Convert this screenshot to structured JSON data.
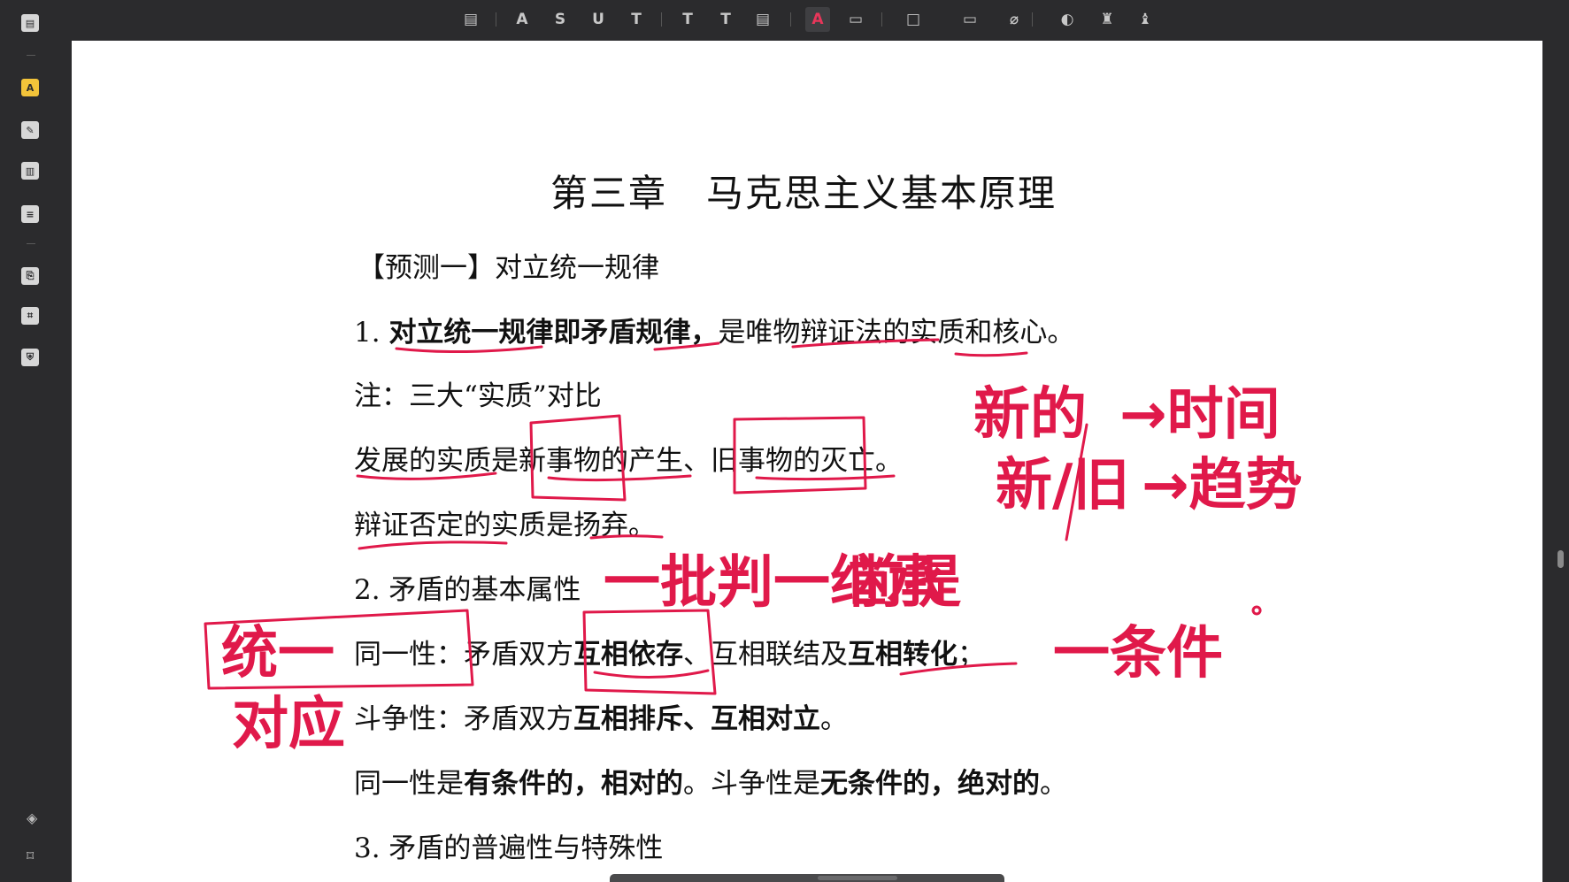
{
  "toolbar": {
    "tools": [
      {
        "name": "comment-icon",
        "glyph": "▤"
      },
      {
        "name": "highlight-icon",
        "glyph": "A"
      },
      {
        "name": "strikethrough-icon",
        "glyph": "S"
      },
      {
        "name": "underline-icon",
        "glyph": "U"
      },
      {
        "name": "squiggly-icon",
        "glyph": "T"
      },
      {
        "name": "text-icon",
        "glyph": "T"
      },
      {
        "name": "textbox-icon",
        "glyph": "T"
      },
      {
        "name": "note-icon",
        "glyph": "▤"
      },
      {
        "name": "pen-icon",
        "glyph": "A"
      },
      {
        "name": "eraser-icon",
        "glyph": "▭"
      },
      {
        "name": "shape-icon",
        "glyph": "□"
      },
      {
        "name": "measure-icon",
        "glyph": "▭"
      },
      {
        "name": "attach-icon",
        "glyph": "⌀"
      },
      {
        "name": "signature-icon",
        "glyph": "◐"
      },
      {
        "name": "stamp-icon",
        "glyph": "♜"
      },
      {
        "name": "highlight-stamp-icon",
        "glyph": "♝"
      }
    ]
  },
  "document": {
    "title": "第三章　马克思主义基本原理",
    "heading1": "【预测一】对立统一规律",
    "line1_num": "1. ",
    "line1_bold": "对立统一规律即矛盾规律，",
    "line1_rest": "是唯物辩证法的实质和核心。",
    "note": "注：三大“实质”对比",
    "line_dev": "发展的实质是新事物的产生、旧事物的灭亡。",
    "line_neg": "辩证否定的实质是扬弃。",
    "heading2": "2. 矛盾的基本属性",
    "identity_a": "同一性：矛盾双方",
    "identity_b": "互相依存",
    "identity_c": "、互相联结及",
    "identity_d": "互相转化",
    "identity_e": "；",
    "struggle_a": "斗争性：矛盾双方",
    "struggle_b": "互相排斥、互相对立",
    "struggle_c": "。",
    "summary_a": "同一性是",
    "summary_b": "有条件的，相对的",
    "summary_c": "。斗争性是",
    "summary_d": "无条件的，绝对的",
    "summary_e": "。",
    "heading3": "3. 矛盾的普遍性与特殊性"
  },
  "handwriting": {
    "new_thing": "新的",
    "time": "→时间",
    "new_old": "新/旧",
    "trend": "→趋势",
    "sublation": "一批判一继承",
    "premise": "前提",
    "unity": "统一",
    "correspond": "对应",
    "condition": "一条件"
  },
  "colors": {
    "ink": "#e0194a",
    "chrome": "#2b2b2d",
    "active_tool": "#f3c43a"
  }
}
